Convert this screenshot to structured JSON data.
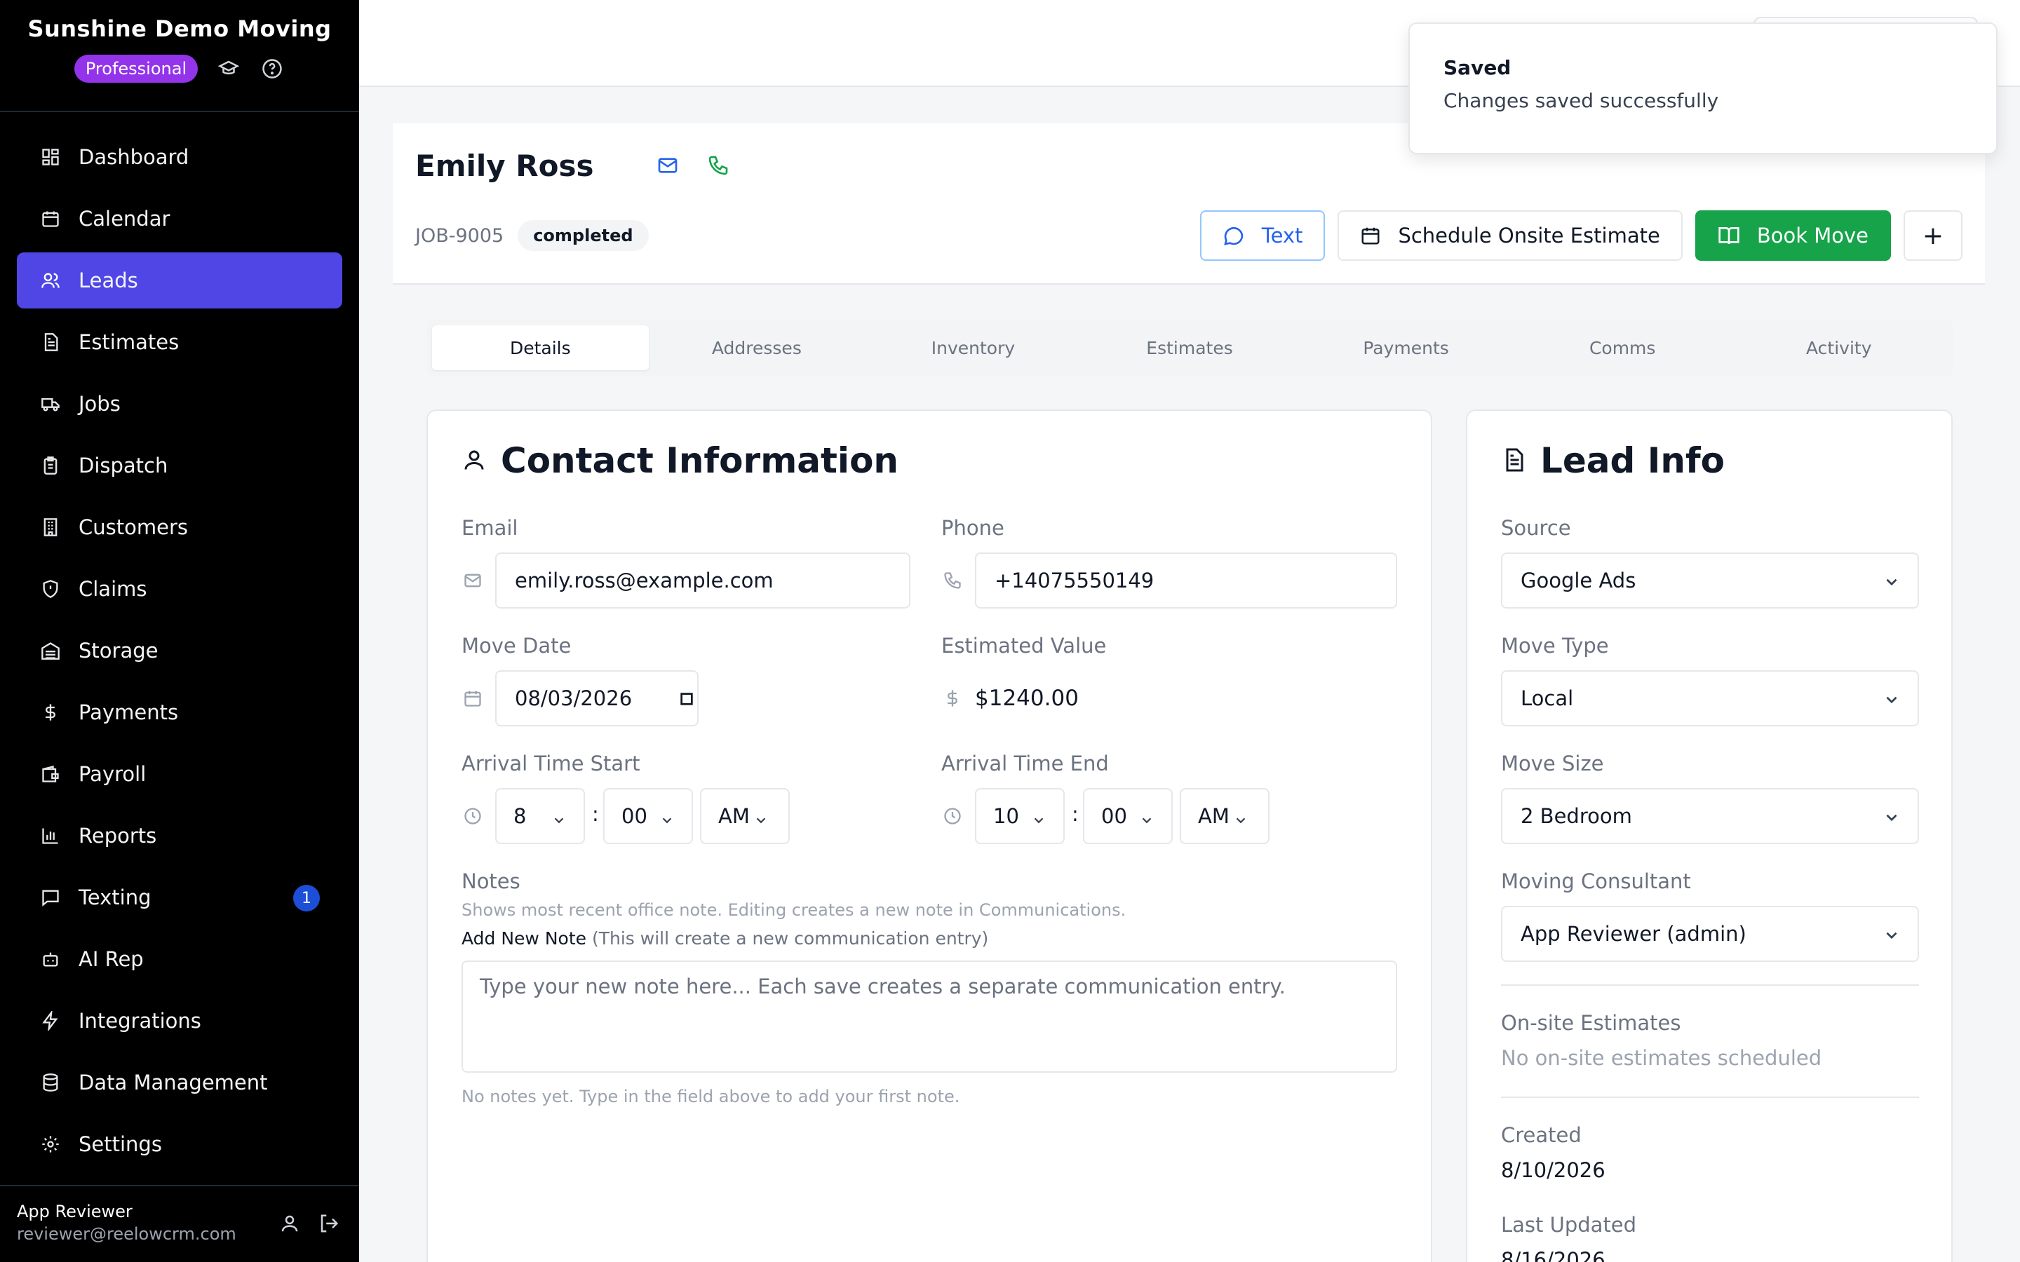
{
  "sidebar": {
    "brand": "Sunshine Demo Moving",
    "plan_badge": "Professional",
    "items": [
      {
        "label": "Dashboard",
        "icon": "dashboard-icon"
      },
      {
        "label": "Calendar",
        "icon": "calendar-icon"
      },
      {
        "label": "Leads",
        "icon": "users-icon",
        "active": true
      },
      {
        "label": "Estimates",
        "icon": "document-icon"
      },
      {
        "label": "Jobs",
        "icon": "truck-icon"
      },
      {
        "label": "Dispatch",
        "icon": "clipboard-icon"
      },
      {
        "label": "Customers",
        "icon": "building-icon"
      },
      {
        "label": "Claims",
        "icon": "shield-icon"
      },
      {
        "label": "Storage",
        "icon": "warehouse-icon"
      },
      {
        "label": "Payments",
        "icon": "dollar-icon"
      },
      {
        "label": "Payroll",
        "icon": "wallet-icon"
      },
      {
        "label": "Reports",
        "icon": "bar-chart-icon"
      },
      {
        "label": "Texting",
        "icon": "message-icon",
        "badge": "1"
      },
      {
        "label": "AI Rep",
        "icon": "bot-icon"
      },
      {
        "label": "Integrations",
        "icon": "zap-icon"
      },
      {
        "label": "Data Management",
        "icon": "database-icon"
      },
      {
        "label": "Settings",
        "icon": "gear-icon"
      }
    ],
    "user": {
      "name": "App Reviewer",
      "email": "reviewer@reelowcrm.com"
    }
  },
  "lead": {
    "name": "Emily Ross",
    "job_id": "JOB-9005",
    "status": "completed",
    "actions": {
      "text": "Text",
      "schedule": "Schedule Onsite Estimate",
      "book": "Book Move",
      "more": "+"
    }
  },
  "tabs": [
    "Details",
    "Addresses",
    "Inventory",
    "Estimates",
    "Payments",
    "Comms",
    "Activity"
  ],
  "contact": {
    "title": "Contact Information",
    "email_label": "Email",
    "email": "emily.ross@example.com",
    "phone_label": "Phone",
    "phone": "+14075550149",
    "move_date_label": "Move Date",
    "move_date": "08/03/2026",
    "estimated_value_label": "Estimated Value",
    "estimated_value": "$1240.00",
    "arrival_start_label": "Arrival Time Start",
    "arrival_start": {
      "hour": "8",
      "minute": "00",
      "period": "AM"
    },
    "arrival_end_label": "Arrival Time End",
    "arrival_end": {
      "hour": "10",
      "minute": "00",
      "period": "AM"
    },
    "notes_label": "Notes",
    "notes_hint": "Shows most recent office note. Editing creates a new note in Communications.",
    "add_note_label": "Add New Note",
    "add_note_sub": "(This will create a new communication entry)",
    "note_placeholder": "Type your new note here... Each save creates a separate communication entry.",
    "no_notes": "No notes yet. Type in the field above to add your first note."
  },
  "lead_info": {
    "title": "Lead Info",
    "source_label": "Source",
    "source": "Google Ads",
    "move_type_label": "Move Type",
    "move_type": "Local",
    "move_size_label": "Move Size",
    "move_size": "2 Bedroom",
    "consultant_label": "Moving Consultant",
    "consultant": "App Reviewer (admin)",
    "onsite_label": "On-site Estimates",
    "onsite_value": "No on-site estimates scheduled",
    "created_label": "Created",
    "created": "8/10/2026",
    "updated_label": "Last Updated",
    "updated": "8/16/2026"
  },
  "toast": {
    "title": "Saved",
    "message": "Changes saved successfully"
  },
  "colors": {
    "accent": "#4f46e5",
    "book": "#16a34a",
    "plan": "#9333ea",
    "text_link": "#2563eb"
  }
}
